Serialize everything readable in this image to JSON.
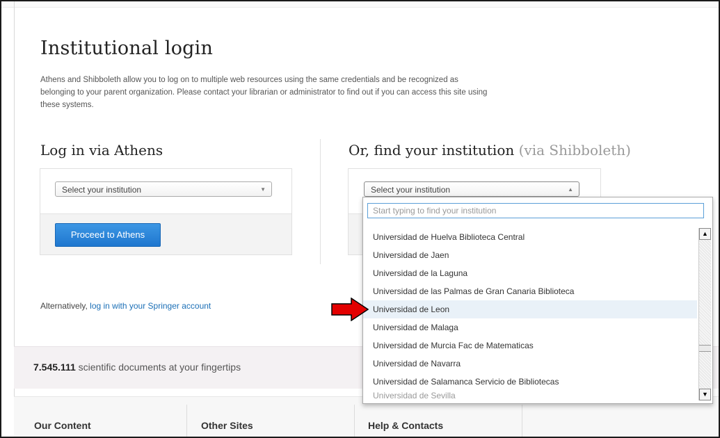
{
  "page": {
    "title": "Institutional login",
    "intro": "Athens and Shibboleth allow you to log on to multiple web resources using the same credentials and be recognized as belonging to your parent organization. Please contact your librarian or administrator to find out if you can access this site using these systems."
  },
  "athens": {
    "heading": "Log in via Athens",
    "select_value": "Select your institution",
    "button_label": "Proceed to Athens"
  },
  "shibboleth": {
    "heading": "Or, find your institution",
    "heading_suffix": "(via Shibboleth)",
    "select_value": "Select your institution",
    "search_placeholder": "Start typing to find your institution",
    "options": [
      "Universidad de Huelva Biblioteca Central",
      "Universidad de Jaen",
      "Universidad de la Laguna",
      "Universidad de las Palmas de Gran Canaria Biblioteca",
      "Universidad de Leon",
      "Universidad de Malaga",
      "Universidad de Murcia Fac de Matematicas",
      "Universidad de Navarra",
      "Universidad de Salamanca Servicio de Bibliotecas",
      "Universidad de Sevilla"
    ],
    "highlighted_option": "Universidad de Leon"
  },
  "alternative": {
    "prefix": "Alternatively,",
    "link": "log in with your Springer account"
  },
  "stats": {
    "count": "7.545.111",
    "text": "scientific documents at your fingertips"
  },
  "footer": {
    "columns": [
      "Our Content",
      "Other Sites",
      "Help & Contacts"
    ]
  },
  "icons": {
    "caret_down": "caret-down-icon",
    "caret_up": "caret-up-icon",
    "annotation_arrow": "red-arrow-icon",
    "accent": "#1f77cf",
    "arrow_color": "#e30000"
  }
}
